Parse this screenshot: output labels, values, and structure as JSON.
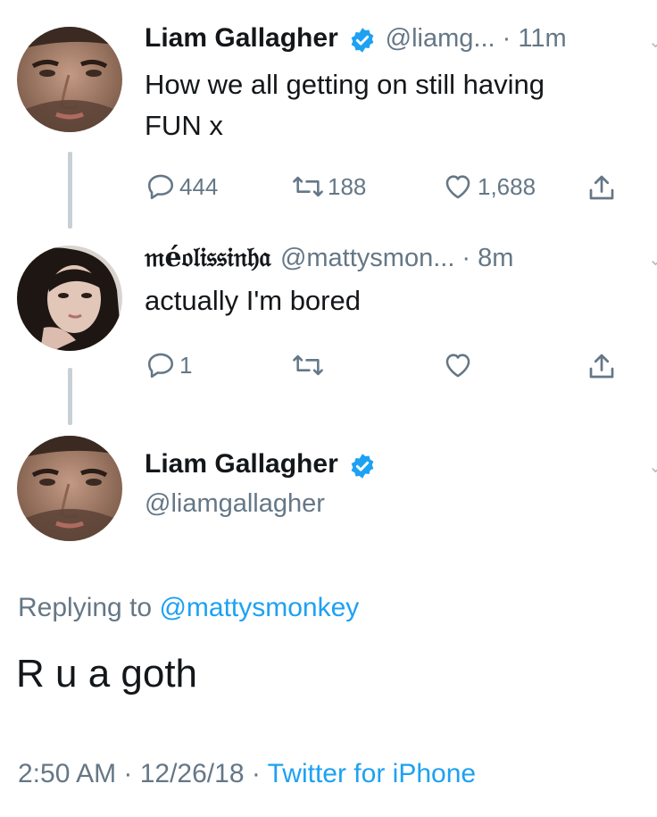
{
  "tweet1": {
    "name": "Liam Gallagher",
    "handle_time": "@liamg... · 11m",
    "text_line1": "How we all getting on still having",
    "text_line2": "FUN x",
    "reply_count": "444",
    "retweet_count": "188",
    "like_count": "1,688"
  },
  "tweet2": {
    "name": "𝔪é𝔬𝔩𝔦𝔰𝔰𝔦𝔫𝔥𝔞",
    "handle_time": "@mattysmon... · 8m",
    "text": "actually I'm bored",
    "reply_count": "1"
  },
  "main": {
    "name": "Liam Gallagher",
    "handle": "@liamgallagher",
    "replying_prefix": "Replying to ",
    "replying_to": "@mattysmonkey",
    "text": "R u a goth",
    "timestamp": "2:50 AM · 12/26/18 · ",
    "source": "Twitter for iPhone"
  },
  "colors": {
    "accent": "#1da1f2",
    "secondary_text": "#657786",
    "verified": "#1da1f2"
  },
  "icons": [
    "reply-icon",
    "retweet-icon",
    "like-icon",
    "share-icon",
    "verified-badge-icon",
    "chevron-down-icon"
  ]
}
